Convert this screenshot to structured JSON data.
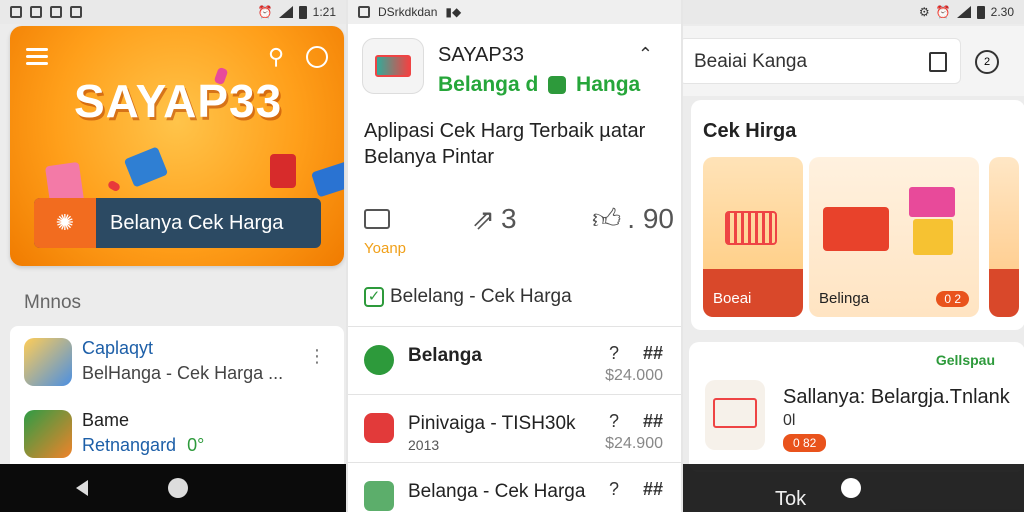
{
  "colors": {
    "orange": "#ff9f1a",
    "green": "#26a63a",
    "navy": "#2c4a63",
    "badge": "#e9531c",
    "dark_bar": "#0b0b0b"
  },
  "screen1": {
    "status_time": "1:21",
    "hero": {
      "brand": "SAYAP33",
      "cta_label": "Belanya Cek Harga",
      "icons": [
        "menu-icon",
        "search-icon",
        "clock-icon",
        "gear-icon"
      ]
    },
    "section_title": "Mnnos",
    "list": [
      {
        "title": "Caplaqyt",
        "subtitle": "BelHanga - Cek Harga ...",
        "icon": "app-icon"
      },
      {
        "title": "Bame",
        "subtitle": "Retnangard",
        "extra": "0°",
        "icon": "app-icon"
      }
    ],
    "navbar": {
      "back": "back-icon",
      "home": "home-icon"
    }
  },
  "screen2": {
    "status_title": "DSrkdkdan",
    "header": {
      "title": "SAYAP33",
      "subtitle": "Belanga d",
      "subtitle2": "Hanga"
    },
    "description": "Aplipasi Cek Harg Terbaik µatar Belanya Pintar",
    "stats": [
      {
        "icon": "basket-icon",
        "value": ""
      },
      {
        "icon": "share-icon",
        "value": "3"
      },
      {
        "icon": "thumb-up-icon",
        "value": ". 90"
      }
    ],
    "stat_label": "Yoanp",
    "check_row": "Belelang - Cek Harga",
    "rows": [
      {
        "title": "Belanga",
        "subtitle": "",
        "q": "?",
        "hash": "##",
        "price": "$24.000",
        "icon_color": "#2d9a3b"
      },
      {
        "title": "Pinivaiga - TISH30k",
        "subtitle": "2013",
        "q": "?",
        "hash": "##",
        "price": "$24.900",
        "icon_color": "#e23a3a"
      },
      {
        "title": "Belanga - Cek Harga",
        "subtitle": "",
        "q": "?",
        "hash": "##",
        "price": "",
        "icon_color": "#5cae6b"
      }
    ]
  },
  "screen3": {
    "status_time": "2.30",
    "search": {
      "value": "Beaiai Kanga"
    },
    "cek_card": {
      "title": "Cek Hirga",
      "tiles": [
        {
          "label": "Boeai",
          "badge": ""
        },
        {
          "label": "Belinga",
          "badge": "0 2"
        }
      ]
    },
    "promo": {
      "tag": "Gellspau",
      "title": "Sallanya: Belargja.Tnlank",
      "num": "0l",
      "badge": "0 82"
    },
    "bottom_label": "Tok"
  }
}
